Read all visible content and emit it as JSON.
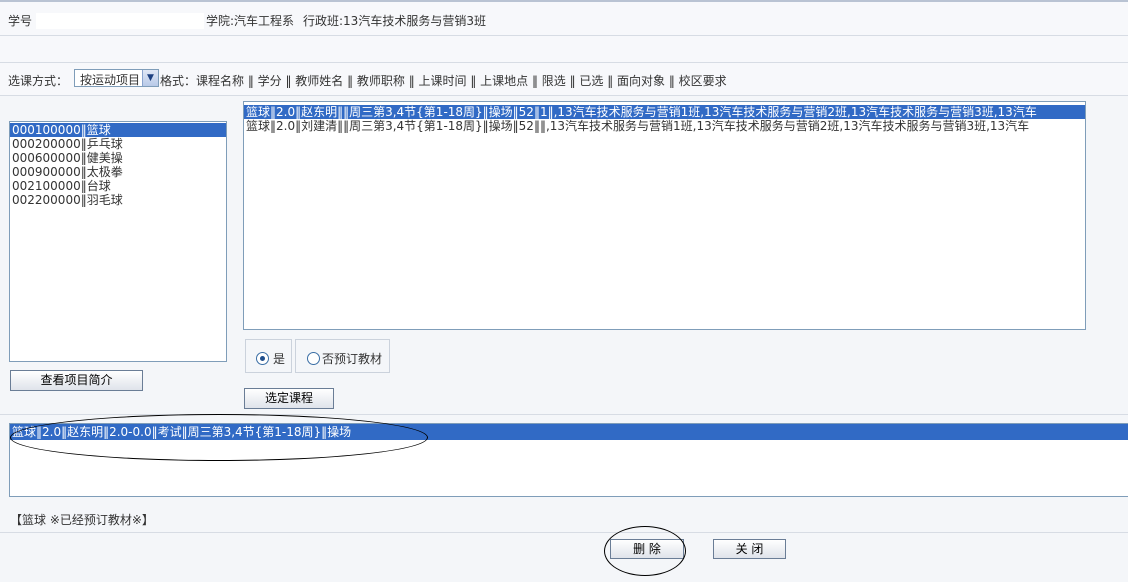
{
  "student": {
    "id_label": "学号",
    "college": "学院:汽车工程系",
    "class_name": "行政班:13汽车技术服务与营销3班"
  },
  "method": {
    "label": "选课方式：",
    "selected": "按运动项目",
    "format": "格式：课程名称 ‖ 学分 ‖ 教师姓名 ‖ 教师职称 ‖ 上课时间 ‖ 上课地点 ‖ 限选 ‖ 已选 ‖ 面向对象 ‖ 校区要求"
  },
  "sports": [
    {
      "label": "000100000‖篮球",
      "selected": true
    },
    {
      "label": "000200000‖乒乓球",
      "selected": false
    },
    {
      "label": "000600000‖健美操",
      "selected": false
    },
    {
      "label": "000900000‖太极拳",
      "selected": false
    },
    {
      "label": "002100000‖台球",
      "selected": false
    },
    {
      "label": "002200000‖羽毛球",
      "selected": false
    }
  ],
  "courses": [
    {
      "label": "篮球‖2.0‖赵东明‖‖周三第3,4节{第1-18周}‖操场‖52‖1‖,13汽车技术服务与营销1班,13汽车技术服务与营销2班,13汽车技术服务与营销3班,13汽车",
      "selected": true
    },
    {
      "label": "篮球‖2.0‖刘建清‖‖周三第3,4节{第1-18周}‖操场‖52‖‖,13汽车技术服务与营销1班,13汽车技术服务与营销2班,13汽车技术服务与营销3班,13汽车",
      "selected": false
    }
  ],
  "buttons": {
    "view_intro": "查看项目简介",
    "select_course": "选定课程",
    "delete": "删  除",
    "close": "关  闭"
  },
  "textbook": {
    "yes": "是",
    "no": "否预订教材",
    "yes_checked": true
  },
  "selected_courses": [
    {
      "label": "篮球‖2.0‖赵东明‖2.0-0.0‖考试‖周三第3,4节{第1-18周}‖操场",
      "selected": true
    }
  ],
  "status_note": "【篮球    ※已经预订教材※】",
  "colors": {
    "selection": "#316ac5",
    "background": "#f4f6f9",
    "border": "#7f9db9"
  }
}
